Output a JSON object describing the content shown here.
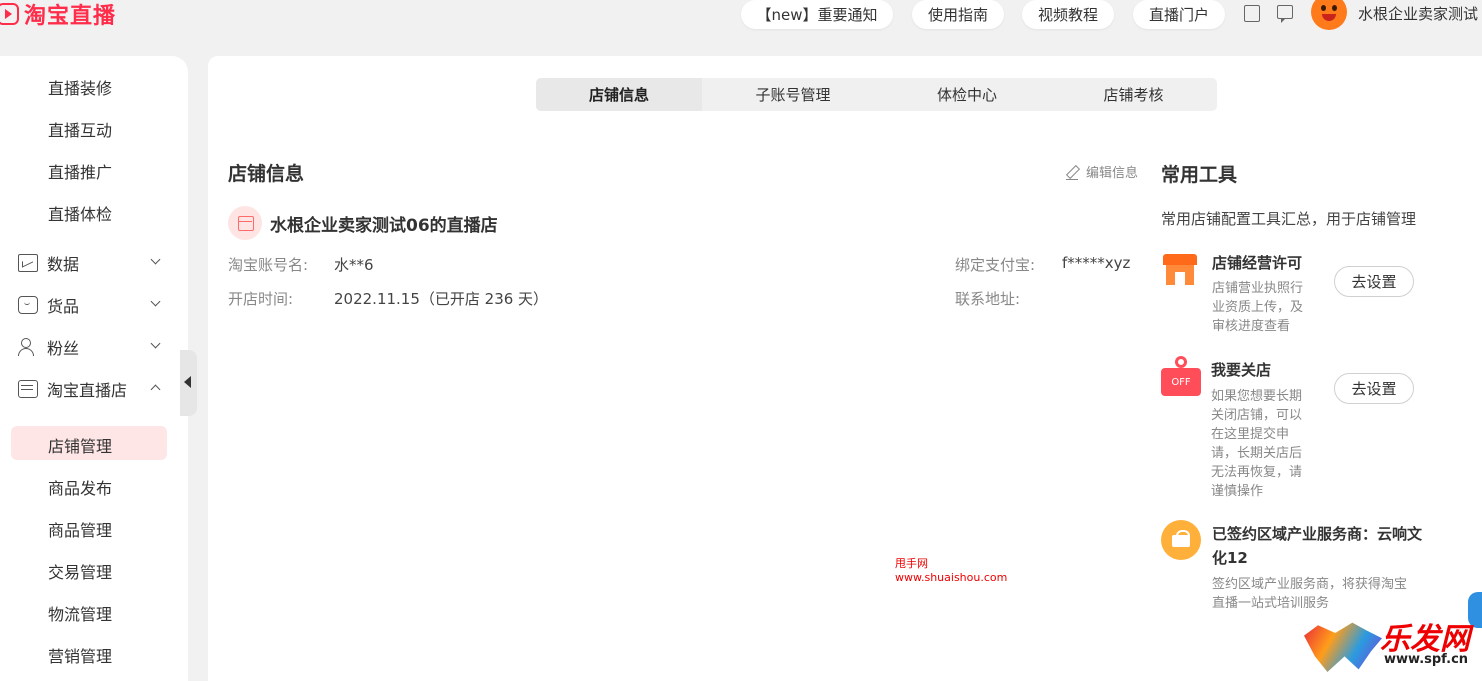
{
  "header": {
    "logo_text": "淘宝直播",
    "nav_buttons": [
      "【new】重要通知",
      "使用指南",
      "视频教程",
      "直播门户"
    ],
    "user_name": "水根企业卖家测试"
  },
  "sidebar": {
    "top_items": [
      "直播装修",
      "直播互动",
      "直播推广",
      "直播体检"
    ],
    "groups": [
      {
        "label": "数据",
        "icon": "chart-icon"
      },
      {
        "label": "货品",
        "icon": "bag-icon"
      },
      {
        "label": "粉丝",
        "icon": "user-icon"
      },
      {
        "label": "淘宝直播店",
        "icon": "store-icon"
      }
    ],
    "sub_items": [
      "店铺管理",
      "商品发布",
      "商品管理",
      "交易管理",
      "物流管理",
      "营销管理"
    ],
    "active_item": "店铺管理"
  },
  "tabs": [
    "店铺信息",
    "子账号管理",
    "体检中心",
    "店铺考核"
  ],
  "shop_info": {
    "section_title": "店铺信息",
    "edit_label": "编辑信息",
    "shop_name": "水根企业卖家测试06的直播店",
    "account_label": "淘宝账号名:",
    "account_value": "水**6",
    "open_label": "开店时间:",
    "open_value": "2022.11.15（已开店 236 天）",
    "alipay_label": "绑定支付宝:",
    "alipay_value": "f*****xyz",
    "address_label": "联系地址:"
  },
  "tools": {
    "title": "常用工具",
    "subtitle": "常用店铺配置工具汇总，用于店铺管理",
    "items": [
      {
        "title": "店铺经营许可",
        "desc": "店铺营业执照行业资质上传，及审核进度查看",
        "button": "去设置"
      },
      {
        "title": "我要关店",
        "icon_text": "OFF",
        "desc": "如果您想要长期关闭店铺，可以在这里提交申请，长期关店后无法再恢复，请谨慎操作",
        "button": "去设置"
      },
      {
        "title": "已签约区域产业服务商：云响文化12",
        "desc": "签约区域产业服务商，将获得淘宝直播一站式培训服务"
      }
    ]
  },
  "watermarks": {
    "center_name": "甩手网",
    "center_url": "www.shuaishou.com",
    "corner_brand": "乐发网",
    "corner_url": "www.spf.cn"
  },
  "colors": {
    "brand_red": "#ff2c4a",
    "active_bg": "#ffe6e6",
    "tool_orange": "#ff6a1a",
    "off_red": "#ff4d5a",
    "partner_yellow": "#ffb03a"
  }
}
